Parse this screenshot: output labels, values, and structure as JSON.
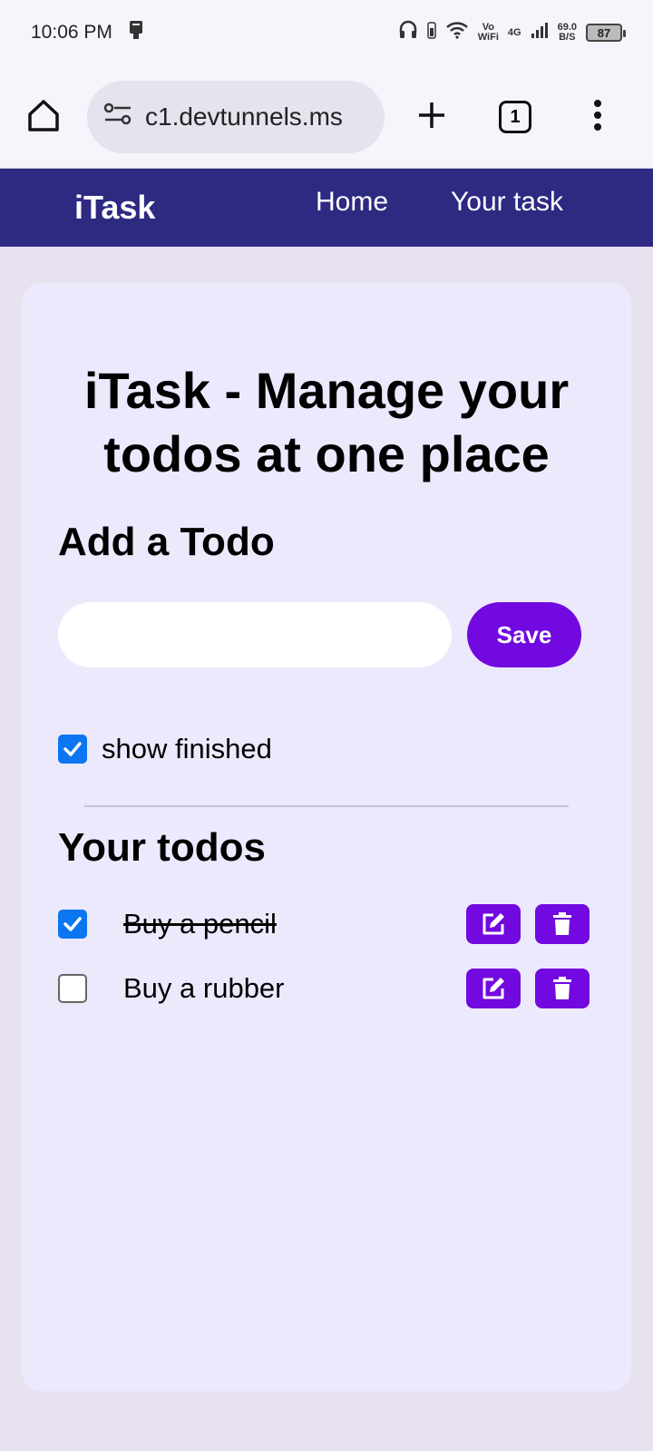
{
  "status_bar": {
    "time": "10:06 PM",
    "network_vo": "Vo",
    "network_wifi": "WiFi",
    "signal_label": "4G",
    "speed_value": "69.0",
    "speed_unit": "B/S",
    "battery": "87"
  },
  "browser": {
    "url": "c1.devtunnels.ms",
    "tab_count": "1"
  },
  "navbar": {
    "brand": "iTask",
    "links": [
      "Home",
      "Your task"
    ]
  },
  "main": {
    "title": "iTask - Manage your todos at one place",
    "add_title": "Add a Todo",
    "input_value": "",
    "input_placeholder": "",
    "save_label": "Save",
    "show_finished_label": "show finished",
    "show_finished_checked": true,
    "todos_title": "Your todos",
    "todos": [
      {
        "text": "Buy a pencil",
        "done": true
      },
      {
        "text": "Buy a rubber",
        "done": false
      }
    ]
  },
  "colors": {
    "navbar": "#2e2a82",
    "accent": "#7109e0",
    "checkbox": "#0b76f0",
    "card": "#ede9fd",
    "page_bg": "#e8e1f0"
  }
}
